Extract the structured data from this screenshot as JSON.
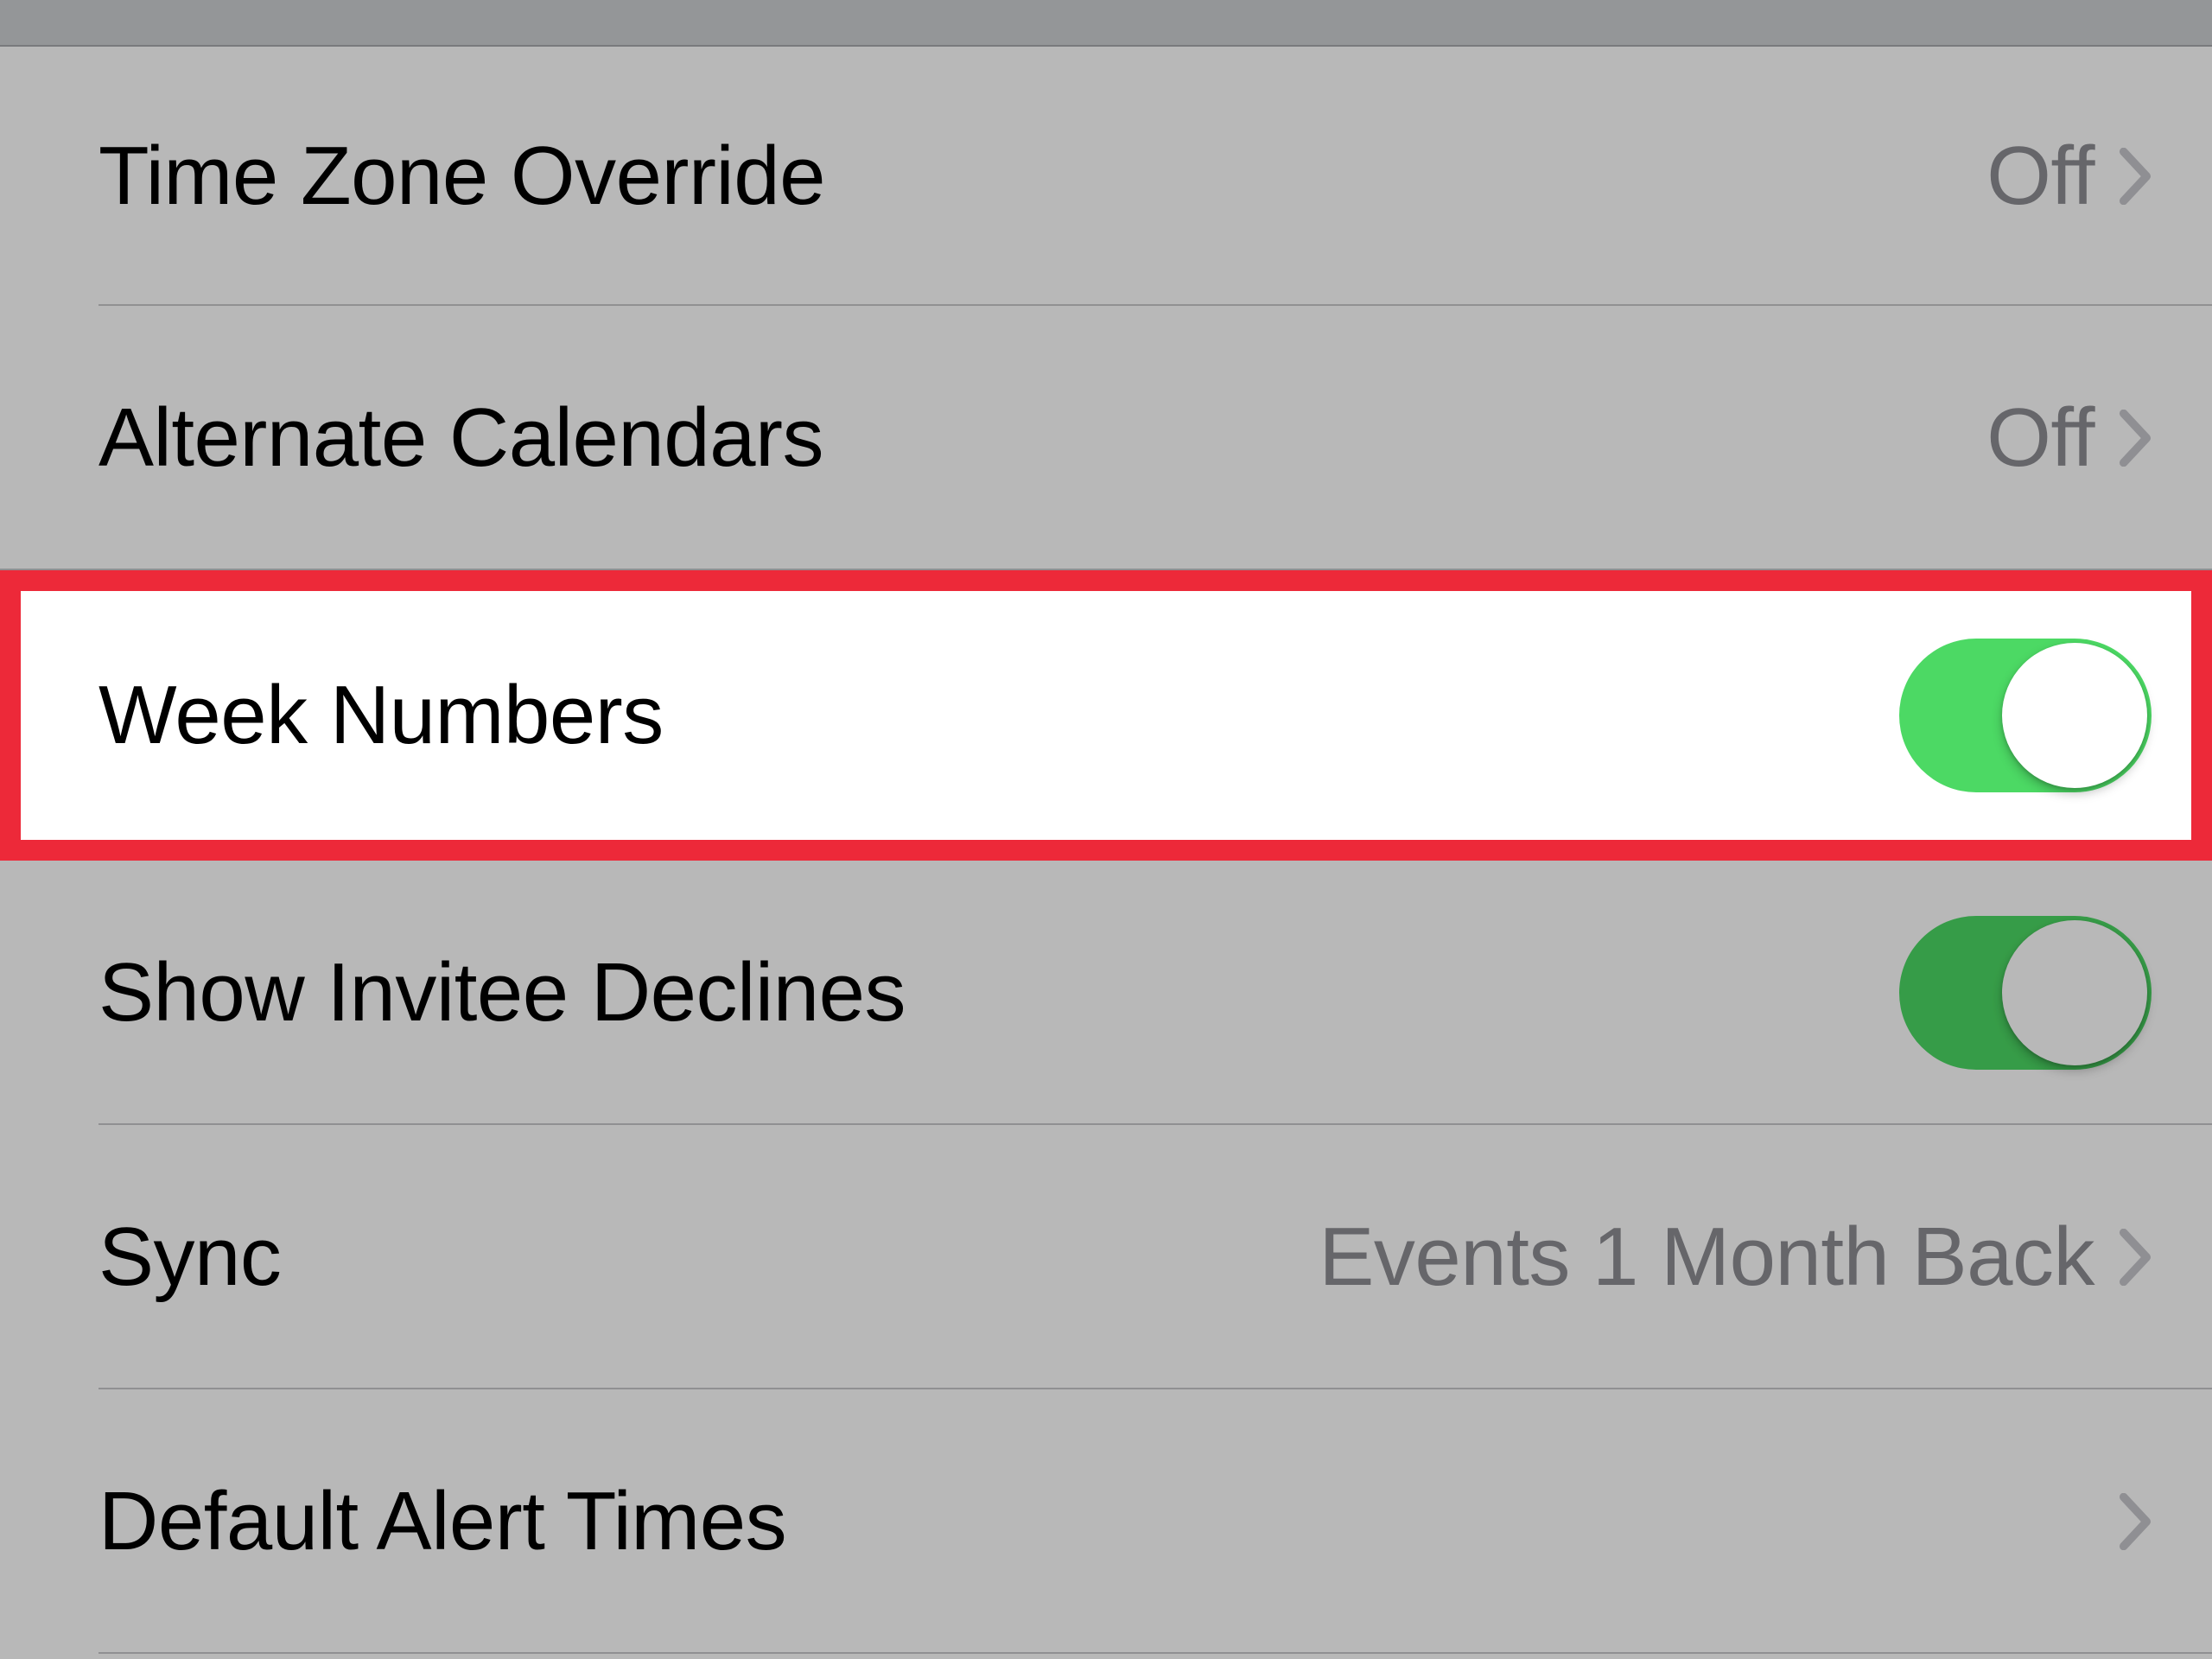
{
  "rows": {
    "timeZoneOverride": {
      "label": "Time Zone Override",
      "value": "Off"
    },
    "alternateCalendars": {
      "label": "Alternate Calendars",
      "value": "Off"
    },
    "weekNumbers": {
      "label": "Week Numbers",
      "toggle": "on"
    },
    "showInviteeDeclines": {
      "label": "Show Invitee Declines",
      "toggle": "on"
    },
    "sync": {
      "label": "Sync",
      "value": "Events 1 Month Back"
    },
    "defaultAlertTimes": {
      "label": "Default Alert Times"
    }
  },
  "colors": {
    "toggleOn": "#4cd964",
    "highlight": "#ed2939"
  }
}
